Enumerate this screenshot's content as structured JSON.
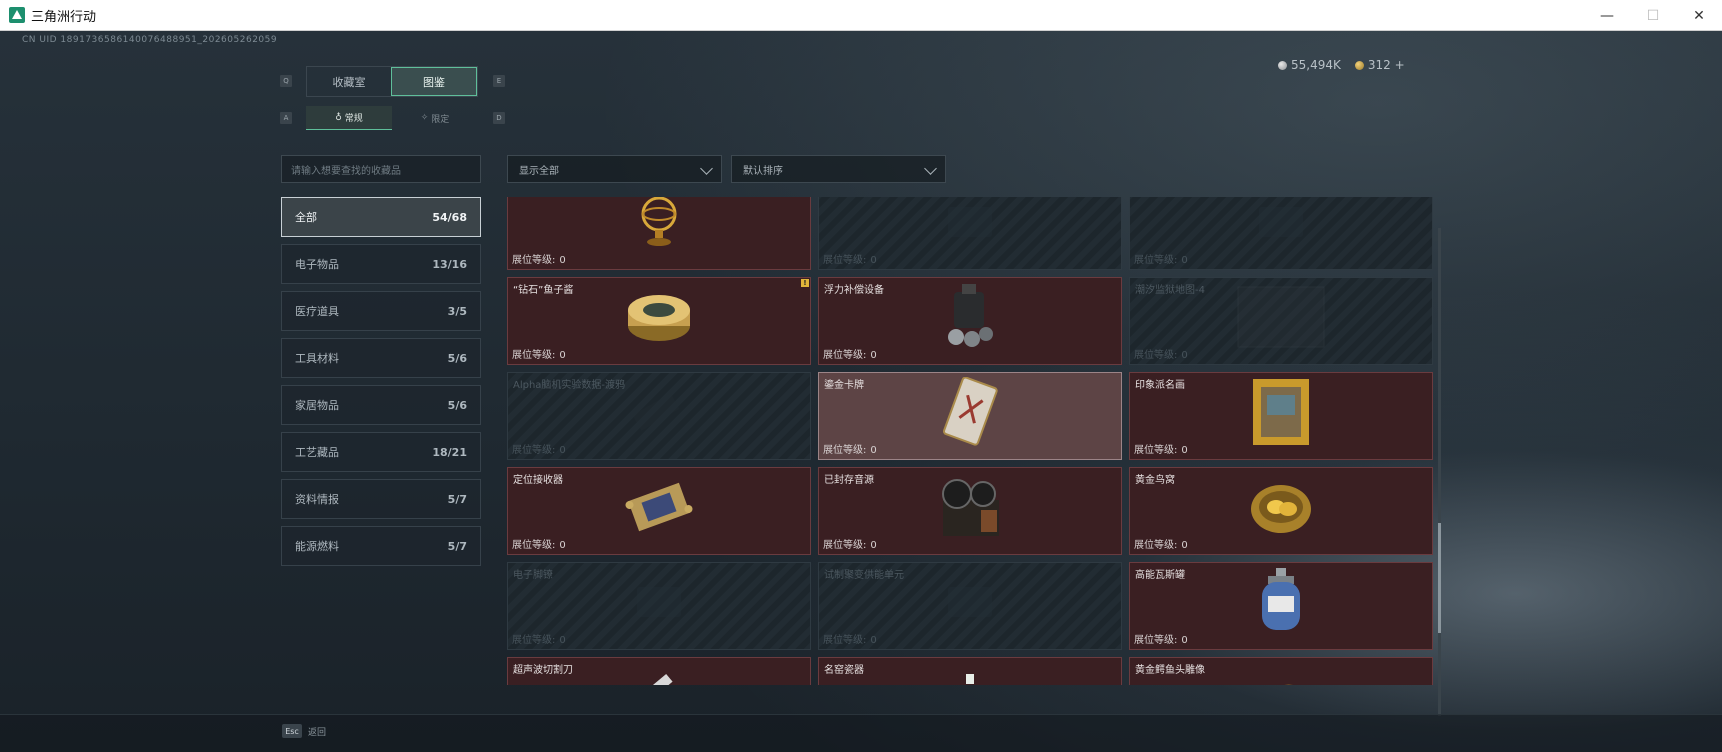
{
  "window": {
    "title": "三角洲行动",
    "controls": [
      "—",
      "☐",
      "✕"
    ]
  },
  "uid": "CN UID 1891736586140076488951_202605262059",
  "currency": {
    "silver": "55,494K",
    "gold": "312",
    "add": "+"
  },
  "tabs": {
    "key_left": "Q",
    "key_right": "E",
    "items": [
      {
        "label": "收藏室"
      },
      {
        "label": "图鉴"
      }
    ]
  },
  "subtabs": {
    "key_left": "A",
    "key_right": "D",
    "items": [
      {
        "label": "常规"
      },
      {
        "label": "限定"
      }
    ]
  },
  "search": {
    "placeholder": "请输入想要查找的收藏品"
  },
  "categories": [
    {
      "label": "全部",
      "count": "54/68"
    },
    {
      "label": "电子物品",
      "count": "13/16"
    },
    {
      "label": "医疗道具",
      "count": "3/5"
    },
    {
      "label": "工具材料",
      "count": "5/6"
    },
    {
      "label": "家居物品",
      "count": "5/6"
    },
    {
      "label": "工艺藏品",
      "count": "18/21"
    },
    {
      "label": "资料情报",
      "count": "5/7"
    },
    {
      "label": "能源燃料",
      "count": "5/7"
    }
  ],
  "filters": {
    "display": "显示全部",
    "sort": "默认排序"
  },
  "level_prefix": "展位等级:",
  "items": [
    {
      "name": "",
      "level": "0",
      "state": "owned",
      "icon": "armillary-sphere-icon"
    },
    {
      "name": "",
      "level": "0",
      "state": "locked",
      "icon": "locked-item-icon"
    },
    {
      "name": "",
      "level": "0",
      "state": "locked",
      "icon": "locked-item-icon"
    },
    {
      "name": "“钻石”鱼子酱",
      "level": "0",
      "state": "owned",
      "icon": "caviar-tin-icon",
      "badge": "!"
    },
    {
      "name": "浮力补偿设备",
      "level": "0",
      "state": "owned",
      "icon": "diving-gear-icon"
    },
    {
      "name": "潮汐监狱地图-4",
      "level": "0",
      "state": "locked",
      "icon": "map-icon"
    },
    {
      "name": "Alpha脑机实验数据-渡鸦",
      "level": "0",
      "state": "locked",
      "icon": "data-drive-icon"
    },
    {
      "name": "鎏金卡牌",
      "level": "0",
      "state": "selected",
      "icon": "card-icon"
    },
    {
      "name": "印象派名画",
      "level": "0",
      "state": "owned",
      "icon": "painting-icon"
    },
    {
      "name": "定位接收器",
      "level": "0",
      "state": "owned",
      "icon": "receiver-icon"
    },
    {
      "name": "已封存音源",
      "level": "0",
      "state": "owned",
      "icon": "reel-recorder-icon"
    },
    {
      "name": "黄金鸟窝",
      "level": "0",
      "state": "owned",
      "icon": "golden-nest-icon"
    },
    {
      "name": "电子脚镣",
      "level": "0",
      "state": "locked",
      "icon": "locked-item-icon"
    },
    {
      "name": "试制聚变供能单元",
      "level": "0",
      "state": "locked",
      "icon": "locked-item-icon"
    },
    {
      "name": "高能瓦斯罐",
      "level": "0",
      "state": "owned",
      "icon": "gas-canister-icon"
    },
    {
      "name": "超声波切割刀",
      "level": "",
      "state": "owned",
      "icon": "cutter-icon"
    },
    {
      "name": "名窑瓷器",
      "level": "",
      "state": "owned",
      "icon": "porcelain-icon"
    },
    {
      "name": "黄金鳄鱼头雕像",
      "level": "",
      "state": "owned",
      "icon": "croc-statue-icon"
    }
  ],
  "bottom": {
    "esc_key": "Esc",
    "back": "返回"
  }
}
